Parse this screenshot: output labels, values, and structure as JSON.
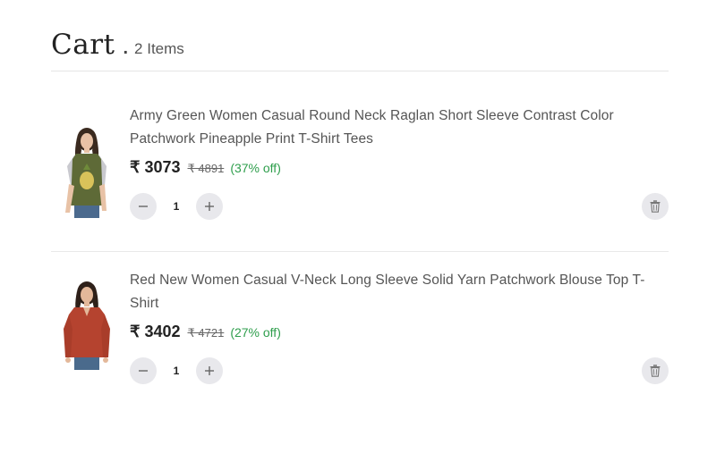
{
  "header": {
    "title": "Cart",
    "separator": ".",
    "count_label": "2 Items"
  },
  "items": [
    {
      "name": "Army Green Women Casual Round Neck Raglan Short Sleeve Contrast Color Patchwork Pineapple Print T-Shirt Tees",
      "price": "₹ 3073",
      "mrp": "₹ 4891",
      "discount": "(37% off)",
      "quantity": "1",
      "decrement_icon": "minus-icon",
      "increment_icon": "plus-icon",
      "remove_icon": "trash-icon"
    },
    {
      "name": "Red New Women Casual V-Neck Long Sleeve Solid Yarn Patchwork Blouse Top T-Shirt",
      "price": "₹ 3402",
      "mrp": "₹ 4721",
      "discount": "(27% off)",
      "quantity": "1",
      "decrement_icon": "minus-icon",
      "increment_icon": "plus-icon",
      "remove_icon": "trash-icon"
    }
  ],
  "colors": {
    "discount_green": "#2e9e4c",
    "button_bg": "#e8e8ec",
    "divider": "#e6e6e6"
  }
}
